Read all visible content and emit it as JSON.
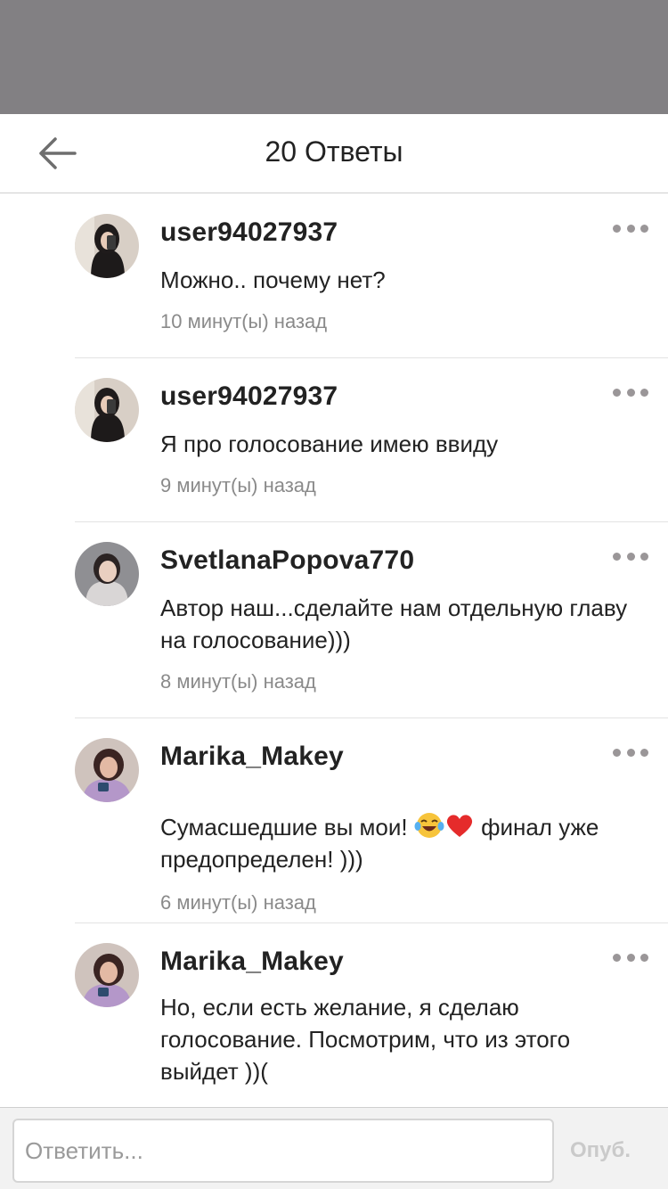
{
  "header": {
    "title": "20 Ответы"
  },
  "replies": [
    {
      "username": "user94027937",
      "text": "Можно.. почему нет?",
      "time": "10 минут(ы) назад"
    },
    {
      "username": "user94027937",
      "text": "Я про голосование имею ввиду",
      "time": "9 минут(ы) назад"
    },
    {
      "username": "SvetlanaPopova770",
      "text": "Автор наш...сделайте нам отдельную главу на голосование)))",
      "time": "8 минут(ы) назад"
    },
    {
      "username": "Marika_Makey",
      "text_before": "Сумасшедшие вы мои! ",
      "text_after": " финал уже предопределен! )))",
      "emojis": [
        "face-with-tears-of-joy",
        "red-heart"
      ],
      "time": "6 минут(ы) назад"
    },
    {
      "username": "Marika_Makey",
      "text": "Но, если есть желание, я сделаю голосование. Посмотрим, что из этого выйдет ))("
    }
  ],
  "composer": {
    "placeholder": "Ответить...",
    "post_label": "Опуб."
  },
  "icons": {
    "back": "arrow-left-icon",
    "more": "more-dots-icon"
  },
  "colors": {
    "overlay": "#828083",
    "text": "#222222",
    "secondary": "#8a8a8a",
    "divider": "#e3e3e3",
    "disabled": "#cacaca"
  }
}
